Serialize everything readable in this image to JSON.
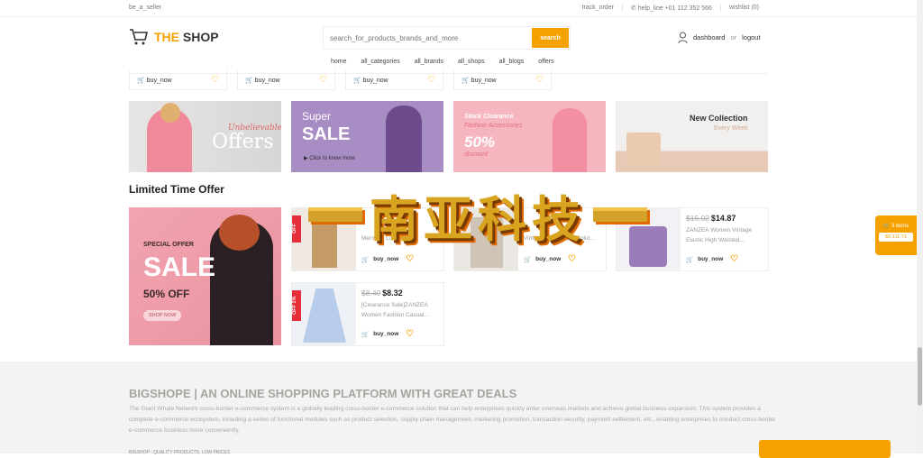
{
  "topbar": {
    "seller": "be_a_seller",
    "track": "track_order",
    "help": "✆ help_line +01 112 352 566",
    "wishlist": "wishlist (0)"
  },
  "header": {
    "logo_accent": "THE",
    "logo_rest": " SHOP",
    "search_placeholder": "search_for_products_brands_and_more",
    "search_button": "search",
    "dashboard": "dashboard",
    "or": "or",
    "logout": "logout"
  },
  "nav": [
    "home",
    "all_categories",
    "all_brands",
    "all_shops",
    "all_blogs",
    "offers"
  ],
  "mini_cards": [
    {
      "buy": "buy_now"
    },
    {
      "buy": "buy_now"
    },
    {
      "buy": "buy_now"
    },
    {
      "buy": "buy_now"
    }
  ],
  "banners": [
    {
      "line1": "Unbelievable",
      "line2": "Offers"
    },
    {
      "line1": "Super",
      "line2": "SALE",
      "line3": "Click to know more"
    },
    {
      "line1": "Stock Clearance",
      "line2": "Fashion Accessories",
      "line3": "50%",
      "line4": "discount"
    },
    {
      "line1": "New Collection",
      "line2": "Every Week"
    }
  ],
  "section_title": "Limited Time Offer",
  "sale_banner": {
    "special": "SPECIAL OFFER",
    "sale": "SALE",
    "off": "50% OFF",
    "button": "SHOP NOW"
  },
  "products": [
    {
      "badge": "OFF",
      "old": "",
      "price": "",
      "title": "Mermaid Long Skirt...",
      "buy": "buy_now"
    },
    {
      "badge": "",
      "old": "",
      "price": "",
      "title": "Vintage Side Zipper Solid...",
      "buy": "buy_now"
    },
    {
      "badge": "",
      "old": "$15.02",
      "price": "$14.87",
      "title": "ZANZEA Women Vintage Elastic High Waisted...",
      "buy": "buy_now"
    },
    {
      "badge": "OFF 1%",
      "old": "$8.40",
      "price": "$8.32",
      "title": "[Clearance Sale]ZANZEA Women Fashion Casual...",
      "buy": "buy_now"
    }
  ],
  "footer": {
    "title": "BIGSHOPE | AN ONLINE SHOPPING PLATFORM WITH GREAT DEALS",
    "text": "The Giant Whale Network cross-border e-commerce system is a globally leading cross-border e-commerce solution that can help enterprises quickly enter overseas markets and achieve global business expansion. This system provides a complete e-commerce ecosystem, including a series of functional modules such as product selection, supply chain management, marketing promotion, transaction security, payment settlement, etc., enabling enterprises to conduct cross-border e-commerce business more conveniently.",
    "tagline": "BIGSHOP - QUALITY PRODUCTS, LOW PRICES"
  },
  "cart": {
    "items": "🛒 3 items",
    "total": "$5,111.71"
  },
  "watermark": "南亚科技",
  "colors": {
    "accent": "#f5a100",
    "badge": "#e62e3b"
  }
}
